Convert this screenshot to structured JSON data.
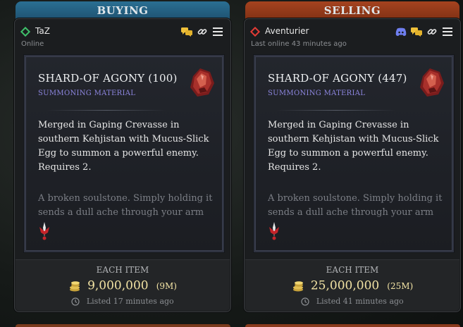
{
  "tabs": {
    "buying": "BUYING",
    "selling": "SELLING"
  },
  "cards": [
    {
      "user": {
        "name": "TaZ",
        "presence": "Online",
        "status_color": "#3fbf6a"
      },
      "icons": [
        "chat-icon",
        "link-icon",
        "menu-icon"
      ],
      "item": {
        "name": "SHARD-OF AGONY (100)",
        "type": "SUMMONING MATERIAL",
        "description": "Merged in Gaping Crevasse in southern Kehjistan with Mucus-Slick Egg to summon a powerful enemy. Requires 2.",
        "flavor": "A broken soulstone. Simply holding it sends a dull ache through your arm"
      },
      "price": {
        "each_label": "EACH ITEM",
        "amount": "9,000,000",
        "short": "(9M)",
        "listed": "Listed 17 minutes ago"
      }
    },
    {
      "user": {
        "name": "Aventurier",
        "presence": "Last online 43 minutes ago",
        "status_color": "#e23b35"
      },
      "icons": [
        "discord-icon",
        "chat-icon",
        "link-icon",
        "menu-icon"
      ],
      "item": {
        "name": "SHARD-OF AGONY (447)",
        "type": "SUMMONING MATERIAL",
        "description": "Merged in Gaping Crevasse in southern Kehjistan with Mucus-Slick Egg to summon a powerful enemy. Requires 2.",
        "flavor": "A broken soulstone. Simply holding it sends a dull ache through your arm"
      },
      "price": {
        "each_label": "EACH ITEM",
        "amount": "25,000,000",
        "short": "(25M)",
        "listed": "Listed 41 minutes ago"
      }
    }
  ],
  "colors": {
    "buying": "#1d4e6b",
    "selling": "#7b2e13",
    "gold": "#f2e3a4",
    "material": "#8d86e0"
  }
}
